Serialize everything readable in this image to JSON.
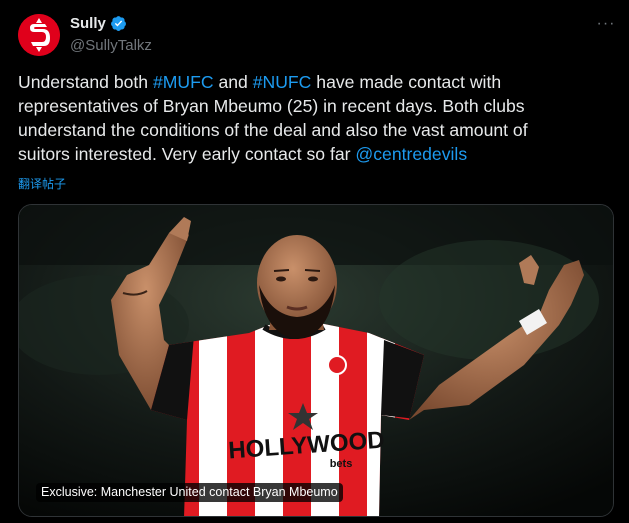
{
  "author": {
    "display_name": "Sully",
    "handle": "@SullyTalkz",
    "avatar_icon": "stylized-s-logo",
    "verified_icon": "verified-badge-icon"
  },
  "colors": {
    "background": "#000000",
    "link": "#1d9bf0",
    "muted": "#71767b",
    "avatar": "#e0001b"
  },
  "menu": {
    "more_label": "···"
  },
  "tweet": {
    "line1_pre": "Understand both ",
    "hashtag1": "#MUFC",
    "line1_mid": " and ",
    "hashtag2": "#NUFC",
    "line1_post": " have made contact with",
    "line2": "representatives of Bryan Mbeumo (25) in recent days. Both clubs",
    "line3": "understand the conditions of the deal and also the vast amount of",
    "line4_pre": "suitors interested. Very early contact so far ",
    "mention": "@centredevils",
    "translate_label": "翻译帖子"
  },
  "media": {
    "caption": "Exclusive: Manchester United contact Bryan Mbeumo",
    "shirt_sponsor": "HOLLYWOOD",
    "shirt_sponsor_sub": "bets"
  }
}
